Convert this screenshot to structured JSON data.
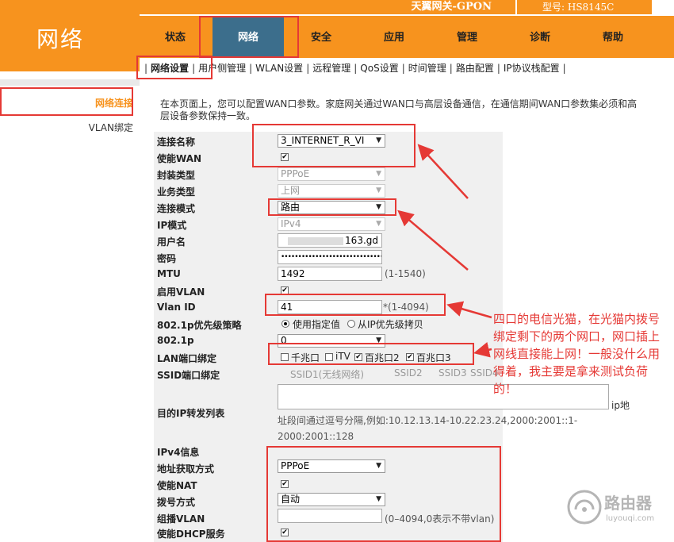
{
  "header": {
    "section_title": "网络",
    "product": "天翼网关-GPON",
    "model": "型号: HS8145C"
  },
  "nav": {
    "tabs": [
      {
        "label": "状态"
      },
      {
        "label": "网络"
      },
      {
        "label": "安全"
      },
      {
        "label": "应用"
      },
      {
        "label": "管理"
      },
      {
        "label": "诊断"
      },
      {
        "label": "帮助"
      }
    ]
  },
  "subnav": {
    "items": [
      "网络设置",
      "用户侧管理",
      "WLAN设置",
      "远程管理",
      "QoS设置",
      "时间管理",
      "路由配置",
      "IP协议栈配置"
    ]
  },
  "sidebar": {
    "items": [
      "网络连接",
      "VLAN绑定"
    ]
  },
  "main": {
    "description": "在本页面上，您可以配置WAN口参数。家庭网关通过WAN口与高层设备通信，在通信期间WAN口参数集必须和高层设备参数保持一致。"
  },
  "form": {
    "conn_name_label": "连接名称",
    "conn_name_value": "3_INTERNET_R_VI",
    "enable_wan_label": "使能WAN",
    "encap_label": "封装类型",
    "encap_value": "PPPoE",
    "service_label": "业务类型",
    "service_value": "上网",
    "conn_mode_label": "连接模式",
    "conn_mode_value": "路由",
    "ip_mode_label": "IP模式",
    "ip_mode_value": "IPv4",
    "username_label": "用户名",
    "username_value": "163.gd",
    "password_label": "密码",
    "password_value": "••••••••••••••••••••••••••••••",
    "mtu_label": "MTU",
    "mtu_value": "1492",
    "mtu_hint": "(1-1540)",
    "enable_vlan_label": "启用VLAN",
    "vlan_id_label": "Vlan ID",
    "vlan_id_value": "41",
    "vlan_id_hint": "*(1-4094)",
    "p8021_policy_label": "802.1p优先级策略",
    "p8021_opt1": "使用指定值",
    "p8021_opt2": "从IP优先级拷贝",
    "p8021_label": "802.1p",
    "p8021_value": "0",
    "lan_bind_label": "LAN端口绑定",
    "lan_ports": [
      "千兆口",
      "iTV",
      "百兆口2",
      "百兆口3"
    ],
    "lan_ports_checked": [
      false,
      false,
      true,
      true
    ],
    "ssid_bind_label": "SSID端口绑定",
    "ssid_ports": [
      "SSID1(无线网络)",
      "SSID2",
      "SSID3",
      "SSID4"
    ],
    "dest_ip_label": "目的IP转发列表",
    "dest_ip_suffix": "ip地",
    "dest_ip_hint": "址段间通过逗号分隔,例如:10.12.13.14-10.22.23.24,2000:2001::1-2000:2001::128",
    "ipv4_info_label": "IPv4信息",
    "addr_method_label": "地址获取方式",
    "addr_method_value": "PPPoE",
    "enable_nat_label": "使能NAT",
    "dial_label": "拨号方式",
    "dial_value": "自动",
    "mcast_vlan_label": "组播VLAN",
    "mcast_vlan_hint": "(0–4094,0表示不带vlan)",
    "enable_dhcp_label": "使能DHCP服务"
  },
  "annotation": "四口的电信光猫，在光猫内拨号绑定剩下的两个网口，网口插上网线直接能上网！一般没什么用得着，我主要是拿来测试负荷的！",
  "watermark": {
    "title": "路由器",
    "sub": "luyouqi.com"
  },
  "colors": {
    "brand_orange": "#f7931e",
    "nav_active": "#3c6e8c",
    "annotation_red": "#e53935"
  }
}
